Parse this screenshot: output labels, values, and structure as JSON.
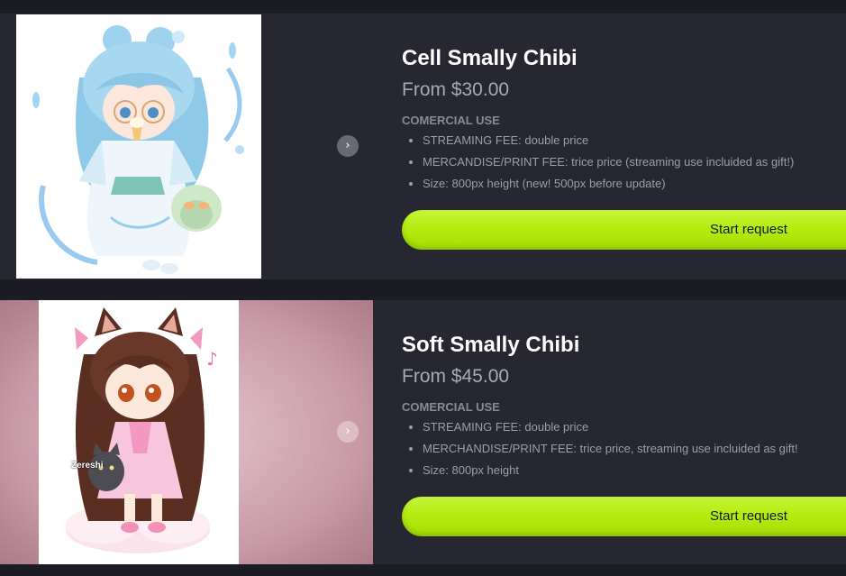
{
  "products": [
    {
      "title": "Cell Smally Chibi",
      "price": "From $30.00",
      "use_label": "COMERCIAL USE",
      "features": [
        "STREAMING FEE: double price",
        "MERCANDISE/PRINT FEE: trice price (streaming use incluided as gift!)",
        "Size: 800px height (new! 500px before update)"
      ],
      "button_label": "Start request",
      "next_icon": "chevron-right-icon"
    },
    {
      "title": "Soft Smally Chibi",
      "price": "From $45.00",
      "use_label": "COMERCIAL USE",
      "features": [
        "STREAMING FEE: double price",
        "MERCHANDISE/PRINT FEE: trice price, streaming use incluided as gift!",
        "Size: 800px height"
      ],
      "button_label": "Start request",
      "next_icon": "chevron-right-icon",
      "watermark": "Zereshi"
    }
  ],
  "colors": {
    "page_background": "#1c1c25",
    "card_background": "#272731",
    "accent_button": "#b4ec10",
    "title_text": "#ffffff",
    "muted_text": "#a9a9b4"
  }
}
